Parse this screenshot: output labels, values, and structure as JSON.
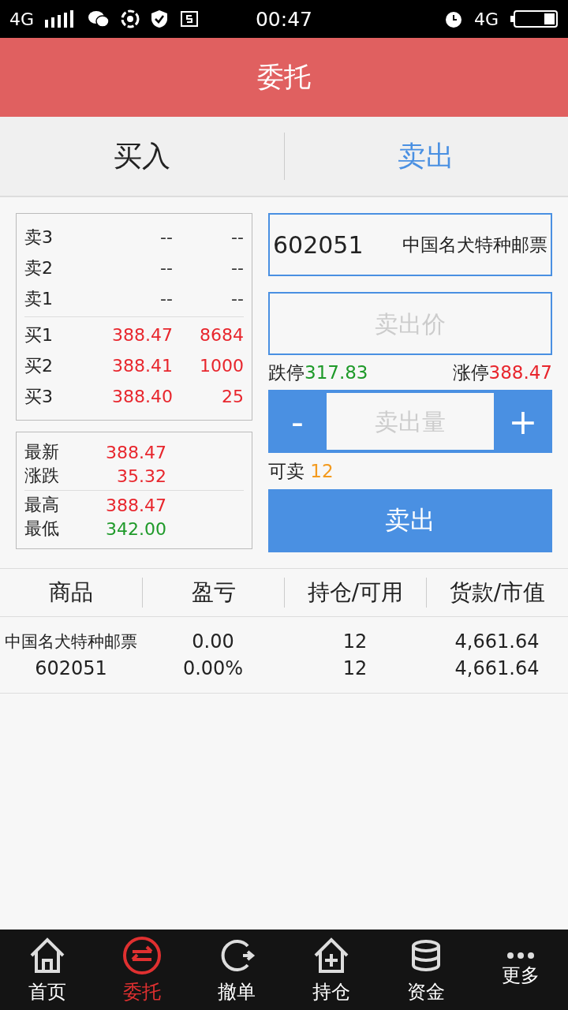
{
  "status_bar": {
    "network": "4G",
    "time": "00:47",
    "network_right": "4G"
  },
  "header": {
    "title": "委托"
  },
  "tabs": [
    {
      "label": "买入",
      "selected": false
    },
    {
      "label": "卖出",
      "selected": true
    }
  ],
  "order_book": {
    "asks": [
      {
        "label": "卖3",
        "price": "--",
        "volume": "--",
        "color": "#333333"
      },
      {
        "label": "卖2",
        "price": "--",
        "volume": "--",
        "color": "#333333"
      },
      {
        "label": "卖1",
        "price": "--",
        "volume": "--",
        "color": "#333333"
      }
    ],
    "bids": [
      {
        "label": "买1",
        "price": "388.47",
        "volume": "8684",
        "color": "#e8262d"
      },
      {
        "label": "买2",
        "price": "388.41",
        "volume": "1000",
        "color": "#e8262d"
      },
      {
        "label": "买3",
        "price": "388.40",
        "volume": "25",
        "color": "#e8262d"
      }
    ]
  },
  "stats": [
    [
      {
        "label": "最新",
        "value": "388.47",
        "color": "#e8262d"
      },
      {
        "label": "涨跌",
        "value": "35.32",
        "color": "#e8262d"
      }
    ],
    [
      {
        "label": "最高",
        "value": "388.47",
        "color": "#e8262d"
      },
      {
        "label": "最低",
        "value": "342.00",
        "color": "#1f9a2a"
      }
    ]
  ],
  "form": {
    "stock_code": "602051",
    "stock_name": "中国名犬特种邮票",
    "price_placeholder": "卖出价",
    "limit_down": {
      "label": "跌停",
      "value": "317.83"
    },
    "limit_up": {
      "label": "涨停",
      "value": "388.47"
    },
    "minus": "-",
    "plus": "+",
    "quantity_placeholder": "卖出量",
    "available": {
      "label": "可卖",
      "value": "12"
    },
    "submit": "卖出"
  },
  "positions": {
    "columns": [
      "商品",
      "盈亏",
      "持仓/可用",
      "货款/市值"
    ],
    "rows": [
      {
        "name": "中国名犬特种邮票",
        "code": "602051",
        "pnl": "0.00",
        "pnl_pct": "0.00%",
        "holding": "12",
        "available": "12",
        "amount": "4,661.64",
        "market_value": "4,661.64"
      }
    ]
  },
  "nav": [
    {
      "label": "首页",
      "kind": "home",
      "selected": false
    },
    {
      "label": "委托",
      "kind": "exchange",
      "selected": true
    },
    {
      "label": "撤单",
      "kind": "undo",
      "selected": false
    },
    {
      "label": "持仓",
      "kind": "holdings",
      "selected": false
    },
    {
      "label": "资金",
      "kind": "funds",
      "selected": false
    },
    {
      "label": "更多",
      "kind": "more",
      "selected": false
    }
  ]
}
